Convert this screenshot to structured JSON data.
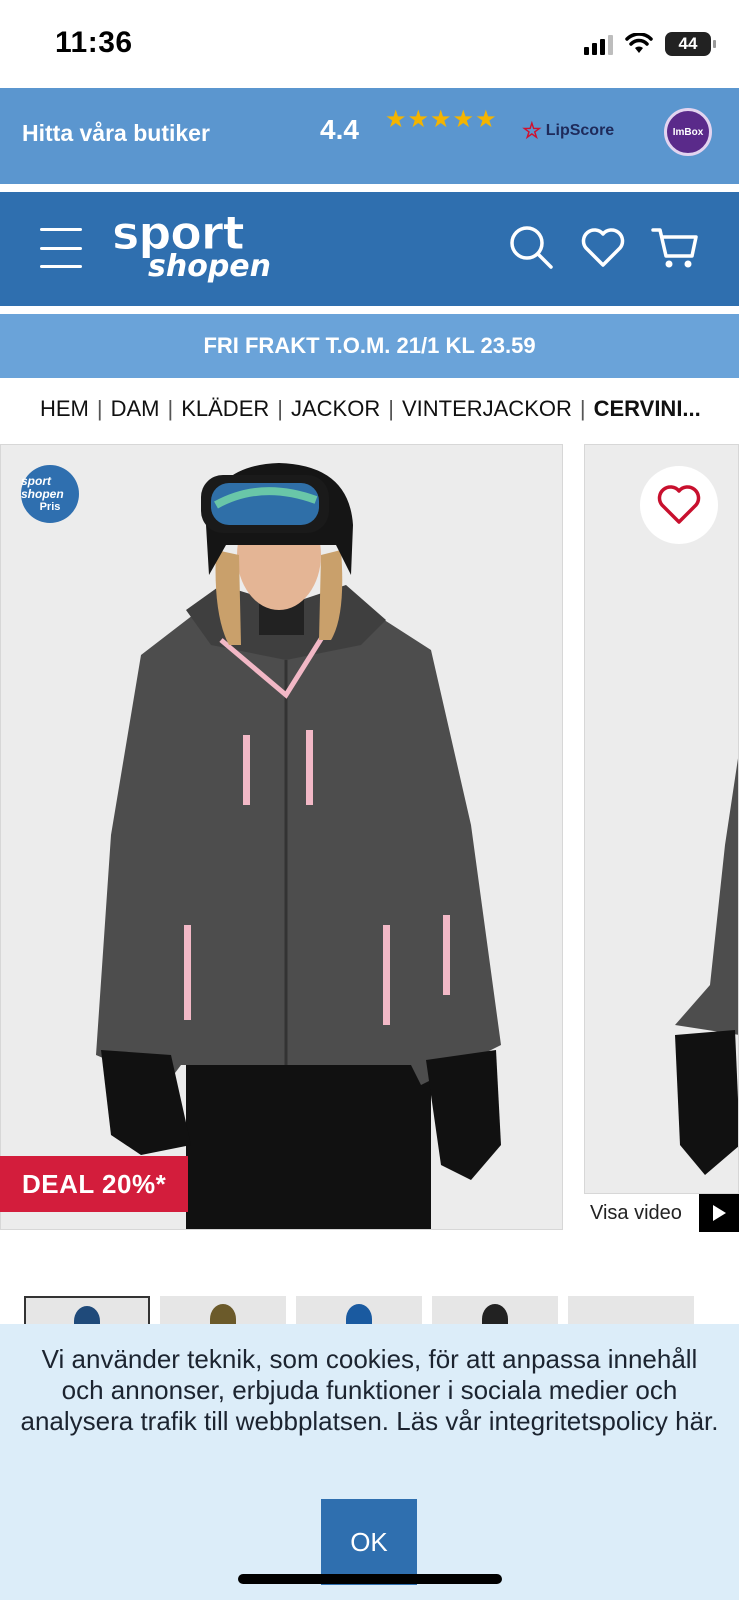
{
  "status_bar": {
    "time": "11:36",
    "battery": "44",
    "icons": [
      "signal-icon",
      "wifi-icon",
      "battery-icon"
    ]
  },
  "rating_bar": {
    "find_stores": "Hitta våra butiker",
    "rating": "4.4",
    "stars_out_of_5": 4.4,
    "lipscore_label": "LipScore",
    "imbox_label": "ImBox"
  },
  "header": {
    "logo_top": "sport",
    "logo_bottom": "shopen",
    "icons": [
      "menu-icon",
      "search-icon",
      "heart-icon",
      "cart-icon"
    ]
  },
  "shipping_banner": "FRI FRAKT T.O.M. 21/1 KL 23.59",
  "breadcrumb": {
    "items": [
      "HEM",
      "DAM",
      "KLÄDER",
      "JACKOR",
      "VINTERJACKOR"
    ],
    "current": "CERVINI..."
  },
  "product": {
    "price_badge_logo": "sport shopen",
    "price_badge_text": "Pris",
    "deal_label": "DEAL 20%*",
    "video_label": "Visa video"
  },
  "cookie_banner": {
    "text": "Vi använder teknik, som cookies, för att anpassa innehåll och annonser, erbjuda funktioner i sociala medier och analysera trafik till webbplatsen. Läs vår integritetspolicy här.",
    "ok_label": "OK"
  },
  "colors": {
    "header_blue": "#2f6faf",
    "light_blue": "#5b96cf",
    "deal_red": "#d31d3c",
    "cookie_bg": "#dcedf9"
  }
}
